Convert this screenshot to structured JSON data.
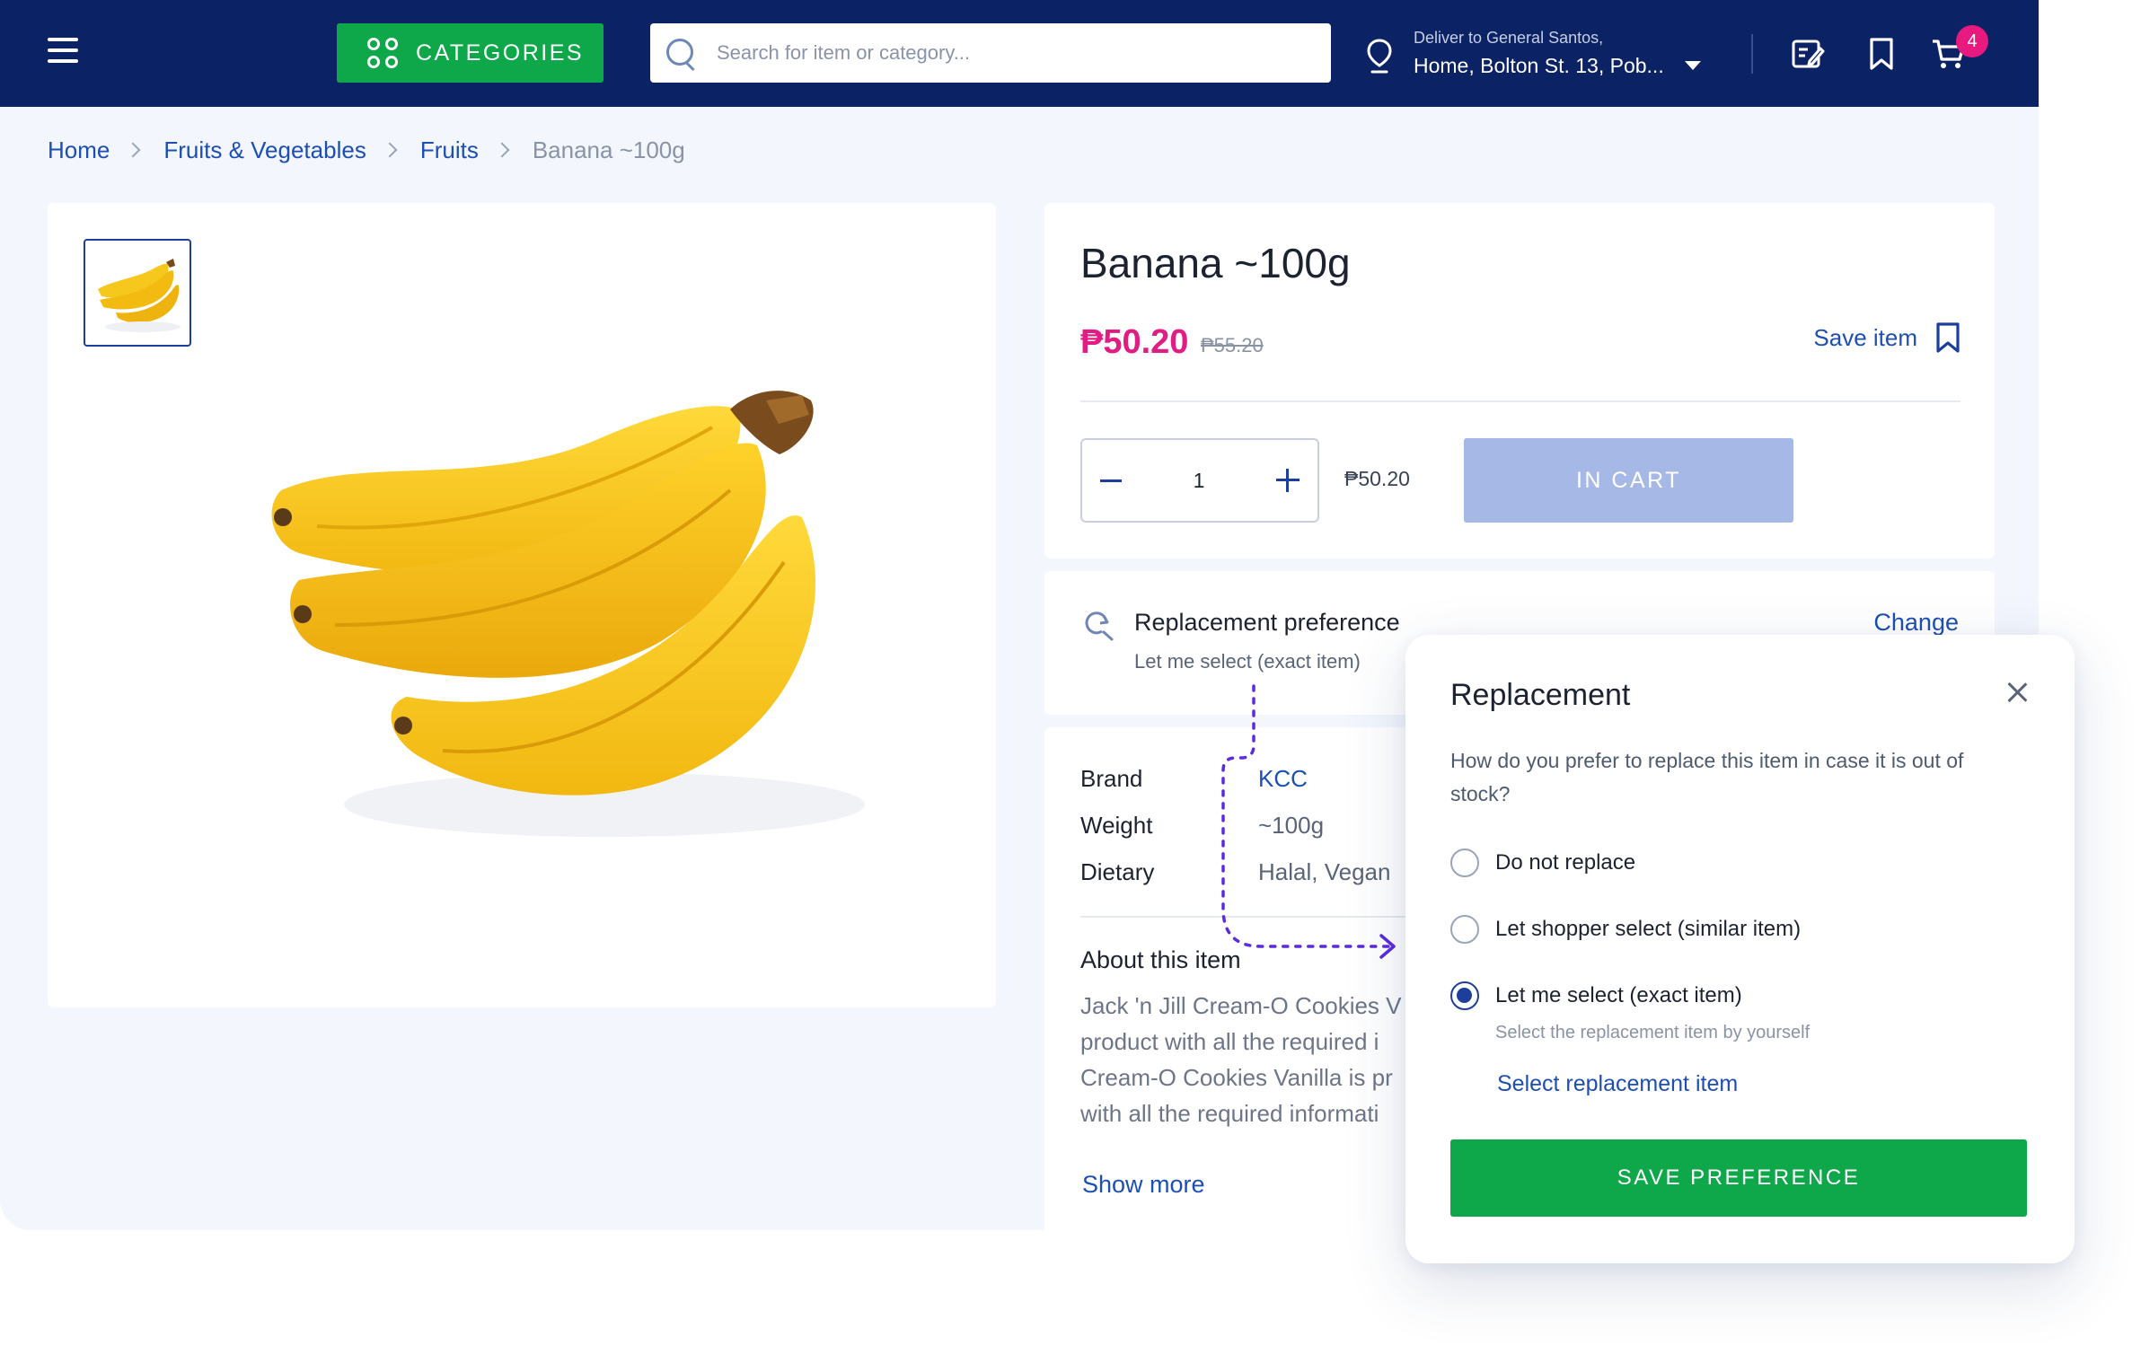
{
  "header": {
    "categories_label": "CATEGORIES",
    "search_placeholder": "Search for item or category...",
    "deliver_label": "Deliver to General Santos,",
    "deliver_address": "Home, Bolton St. 13, Pob...",
    "cart_count": "4",
    "brand_color": "#0b2265",
    "accent_green": "#0ea84a",
    "icons": [
      "menu-icon",
      "grid-icon",
      "search-icon",
      "location-pin-icon",
      "chevron-down-icon",
      "edit-list-icon",
      "bookmark-icon",
      "cart-icon"
    ]
  },
  "breadcrumb": {
    "home": "Home",
    "level1": "Fruits & Vegetables",
    "level2": "Fruits",
    "current": "Banana ~100g"
  },
  "product": {
    "title": "Banana ~100g",
    "price": "₱50.20",
    "old_price": "₱55.20",
    "price_color": "#e11d84",
    "save_label": "Save item",
    "quantity": "1",
    "line_total": "₱50.20",
    "cart_button": "IN CART"
  },
  "replacement": {
    "title": "Replacement preference",
    "current": "Let me select (exact item)",
    "change_label": "Change"
  },
  "specs": [
    {
      "label": "Brand",
      "value": "KCC"
    },
    {
      "label": "Weight",
      "value": "~100g"
    },
    {
      "label": "Dietary",
      "value": "Halal, Vegan"
    }
  ],
  "about": {
    "title": "About this item",
    "lines": [
      "Jack 'n Jill Cream-O Cookies V",
      "product with all the required i",
      "Cream-O Cookies Vanilla is pr",
      "with all the required informati"
    ],
    "show_more": "Show more"
  },
  "modal": {
    "title": "Replacement",
    "question": "How do you prefer to replace this item in case it is out of stock?",
    "options": [
      {
        "label": "Do not replace",
        "checked": false
      },
      {
        "label": "Let shopper select (similar item)",
        "checked": false
      },
      {
        "label": "Let me select (exact item)",
        "checked": true
      }
    ],
    "selected_hint": "Select the replacement item by yourself",
    "select_link": "Select replacement item",
    "save_button": "SAVE PREFERENCE"
  }
}
